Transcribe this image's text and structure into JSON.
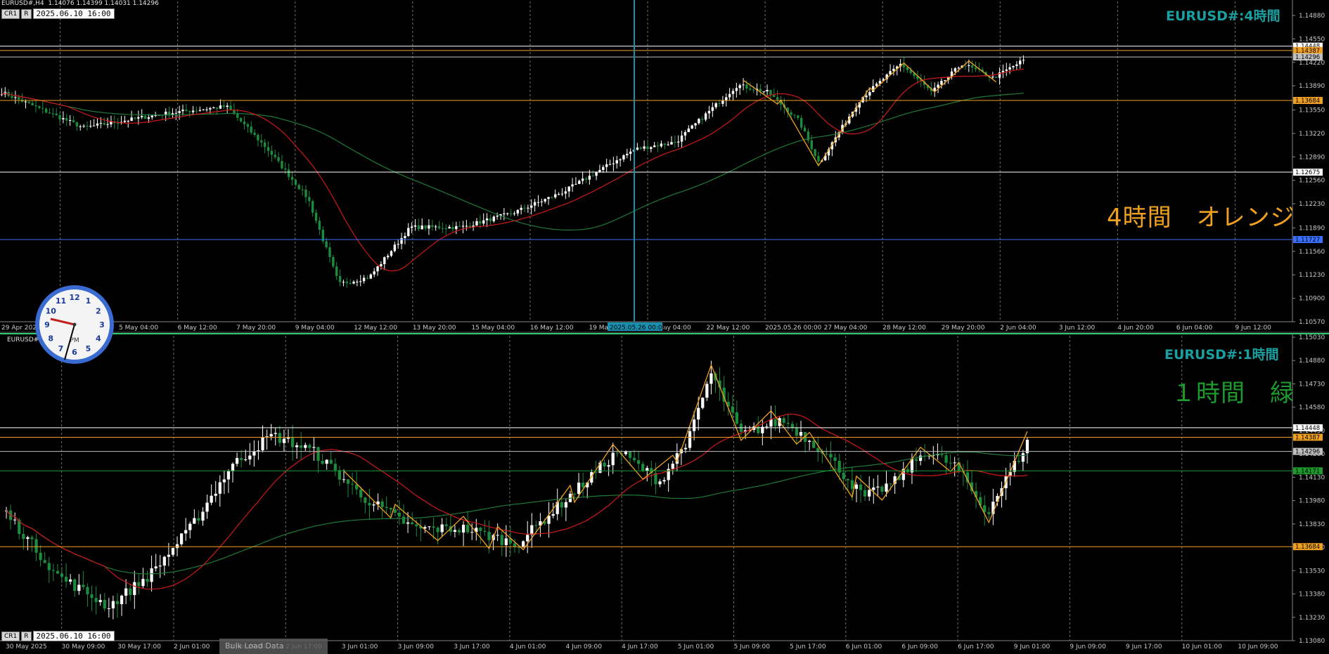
{
  "top_chart": {
    "header": "EURUSD#,H4  1.14076 1.14399 1.14031 1.14296",
    "buttons": [
      "CR1",
      "R"
    ],
    "date_field": "2025.06.10 16:00",
    "title": "EURUSD#:4時間",
    "note": "4時間　オレンジ",
    "price_ticks": [
      "1.14880",
      "1.14550",
      "1.14220",
      "1.13890",
      "1.13550",
      "1.13220",
      "1.12890",
      "1.12560",
      "1.12230",
      "1.11890",
      "1.11560",
      "1.11230",
      "1.10900",
      "1.10570"
    ],
    "price_ymin": 1.1057,
    "price_ymax": 1.1488,
    "level_labels": [
      {
        "text": "1.14448",
        "color": "#ffffff",
        "price": 1.14448
      },
      {
        "text": "1.14387",
        "color": "#f0a020",
        "price": 1.14387
      },
      {
        "text": "1.14296",
        "color": "#c0c0c0",
        "price": 1.14296
      },
      {
        "text": "1.13684",
        "color": "#f0a020",
        "price": 1.13684
      },
      {
        "text": "1.12675",
        "color": "#ffffff",
        "price": 1.12675
      },
      {
        "text": "1.11727",
        "color": "#3a70ff",
        "price": 1.11727
      }
    ],
    "time_ticks": [
      "29 Apr 2025",
      "2 May 12:00",
      "5 May 04:00",
      "6 May 12:00",
      "7 May 20:00",
      "9 May 04:00",
      "12 May 12:00",
      "13 May 20:00",
      "15 May 04:00",
      "16 May 12:00",
      "19 May 20:00",
      "21 May 04:00",
      "22 May 12:00",
      "2025.05.26 00:00",
      "27 May 04:00",
      "28 May 12:00",
      "29 May 20:00",
      "2 Jun 04:00",
      "3 Jun 12:00",
      "4 Jun 20:00",
      "6 Jun 04:00",
      "9 Jun 12:00"
    ],
    "crosshair_label": "2025.05.26 00:00"
  },
  "bottom_chart": {
    "header": "EURUSD#,H1  1.14243 1.14296",
    "buttons": [
      "CR1",
      "R"
    ],
    "date_field": "2025.06.10 16:00",
    "title": "EURUSD#:1時間",
    "note": "１時間　緑",
    "price_ticks": [
      "1.15030",
      "1.14880",
      "1.14730",
      "1.14580",
      "1.14430",
      "1.14280",
      "1.14130",
      "1.13980",
      "1.13830",
      "1.13680",
      "1.13530",
      "1.13380",
      "1.13230",
      "1.13080"
    ],
    "price_ymin": 1.1308,
    "price_ymax": 1.1503,
    "level_labels": [
      {
        "text": "1.14448",
        "color": "#ffffff",
        "price": 1.14448
      },
      {
        "text": "1.14387",
        "color": "#f0a020",
        "price": 1.14387
      },
      {
        "text": "1.14296",
        "color": "#c0c0c0",
        "price": 1.14296
      },
      {
        "text": "1.14171",
        "color": "#1c9a2c",
        "price": 1.14171
      },
      {
        "text": "1.13684",
        "color": "#f0a020",
        "price": 1.13684
      }
    ],
    "time_ticks": [
      "30 May 2025",
      "30 May 09:00",
      "30 May 17:00",
      "2 Jun 01:00",
      "2 Jun 09:00",
      "2 Jun 17:00",
      "3 Jun 01:00",
      "3 Jun 09:00",
      "3 Jun 17:00",
      "4 Jun 01:00",
      "4 Jun 09:00",
      "4 Jun 17:00",
      "5 Jun 01:00",
      "5 Jun 09:00",
      "5 Jun 17:00",
      "6 Jun 01:00",
      "6 Jun 09:00",
      "6 Jun 17:00",
      "9 Jun 01:00",
      "9 Jun 09:00",
      "9 Jun 17:00",
      "10 Jun 01:00",
      "10 Jun 09:00"
    ]
  },
  "clock": {
    "pm_label": "PM",
    "numbers": [
      "12",
      "1",
      "2",
      "3",
      "4",
      "5",
      "6",
      "7",
      "8",
      "9",
      "10",
      "11"
    ]
  },
  "overlay_button": {
    "label": "Bulk Load Data"
  },
  "colors": {
    "bull": "#ffffff",
    "bear": "#1c8c3c",
    "ma_fast": "#d01818",
    "ma_slow": "#1e7a3a",
    "zigzag": "#f0a020",
    "grid": "#707070",
    "crosshair": "#1a90b0"
  }
}
